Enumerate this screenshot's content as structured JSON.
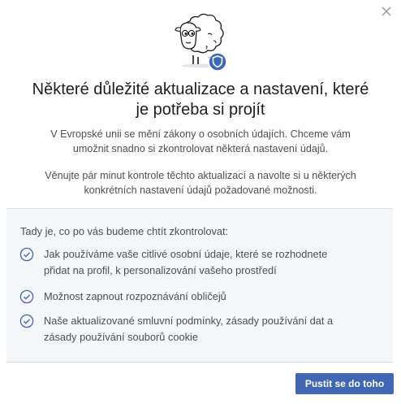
{
  "dialog": {
    "close_icon": "close-icon",
    "hero_icon": "sheep-with-shield-icon",
    "title_lines": [
      "Některé důležité aktualizace a nastavení, které",
      "je potřeba si projít"
    ],
    "description_1_lines": [
      "V Evropské unii se mění zákony o osobních údajích. Chceme vám",
      "umožnit snadno si zkontrolovat některá nastavení údajů."
    ],
    "description_2_lines": [
      "Věnujte pár minut kontrole těchto aktualizací a navolte si u některých",
      "konkrétních nastavení údajů požadované možnosti."
    ]
  },
  "review_panel": {
    "intro": "Tady je, co po vás budeme chtít zkontrolovat:",
    "items": [
      {
        "icon": "check-circle-icon",
        "lines": [
          "Jak používáme vaše citlivé osobní údaje, které se rozhodnete",
          "přidat na profil, k personalizování vašeho prostředí"
        ]
      },
      {
        "icon": "check-circle-icon",
        "lines": [
          "Možnost zapnout rozpoznávání obličejů"
        ]
      },
      {
        "icon": "check-circle-icon",
        "lines": [
          "Naše aktualizované smluvní podmínky, zásady používání dat a",
          "zásady používání souborů cookie"
        ]
      }
    ]
  },
  "footer": {
    "primary_button_label": "Pustit se do toho"
  },
  "colors": {
    "accent": "#4267b2",
    "panel_bg": "#f5f6f7",
    "check": "#4267b2"
  }
}
